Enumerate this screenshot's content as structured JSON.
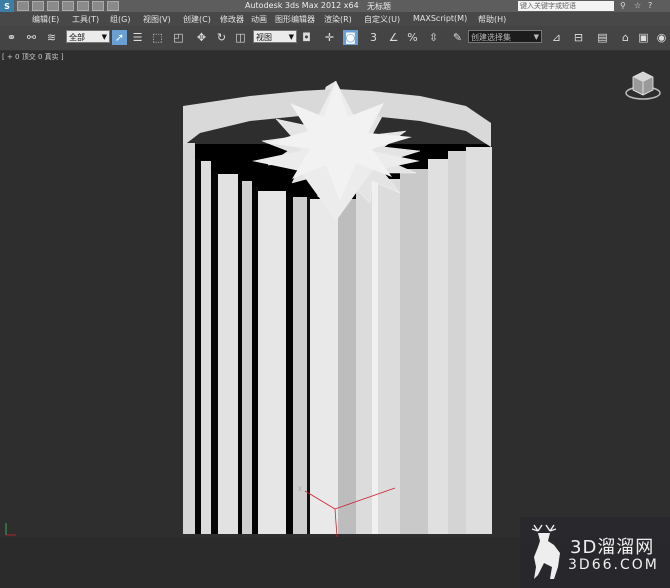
{
  "title": {
    "app": "Autodesk 3ds Max  2012 x64",
    "file": "无标题",
    "search_placeholder": "键入关键字或短语"
  },
  "menu": [
    "编辑(E)",
    "工具(T)",
    "组(G)",
    "视图(V)",
    "创建(C)",
    "修改器",
    "动画",
    "图形编辑器",
    "渲染(R)",
    "自定义(U)",
    "MAXScript(M)",
    "帮助(H)"
  ],
  "toolbar": {
    "filter_value": "全部",
    "coord_value": "视图",
    "snap_label": "3",
    "selection_set_placeholder": "创建选择集"
  },
  "viewport": {
    "label": "[ + 0 顶交 0 真实 ]"
  },
  "watermark": {
    "line1": "3D溜溜网",
    "line2": "3D66.COM"
  },
  "colors": {
    "viewport_bg": "#2e2e2e",
    "menubar_bg": "#484848",
    "toolbar_bg": "#444444",
    "active_tool": "#6a9fd6",
    "model": "#d8d8d8"
  }
}
